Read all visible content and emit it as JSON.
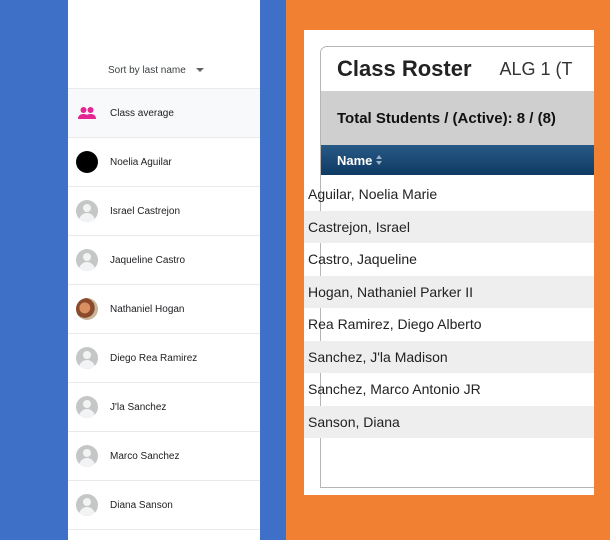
{
  "classroom": {
    "sort_label": "Sort by last name",
    "rows": [
      {
        "label": "Class average",
        "avatar": "group-icon"
      },
      {
        "label": "Noelia Aguilar",
        "avatar": "black-avatar"
      },
      {
        "label": "Israel Castrejon",
        "avatar": "default-avatar"
      },
      {
        "label": "Jaqueline Castro",
        "avatar": "default-avatar"
      },
      {
        "label": "Nathaniel Hogan",
        "avatar": "photo-avatar"
      },
      {
        "label": "Diego Rea Ramirez",
        "avatar": "default-avatar"
      },
      {
        "label": "J'la Sanchez",
        "avatar": "default-avatar"
      },
      {
        "label": "Marco Sanchez",
        "avatar": "default-avatar"
      },
      {
        "label": "Diana Sanson",
        "avatar": "default-avatar"
      }
    ]
  },
  "roster": {
    "title": "Class Roster",
    "course": "ALG 1 (T",
    "total": "Total Students / (Active): 8 / (8)",
    "column_name": "Name",
    "students": [
      "Aguilar, Noelia Marie",
      "Castrejon, Israel",
      "Castro, Jaqueline",
      "Hogan, Nathaniel Parker II",
      "Rea Ramirez, Diego Alberto",
      "Sanchez, J'la Madison",
      "Sanchez, Marco Antonio JR",
      "Sanson, Diana"
    ]
  },
  "colors": {
    "blue_band": "#3f70c7",
    "orange_frame": "#f18033",
    "header_blue": "#1d4b78",
    "group_icon": "#e52592"
  }
}
